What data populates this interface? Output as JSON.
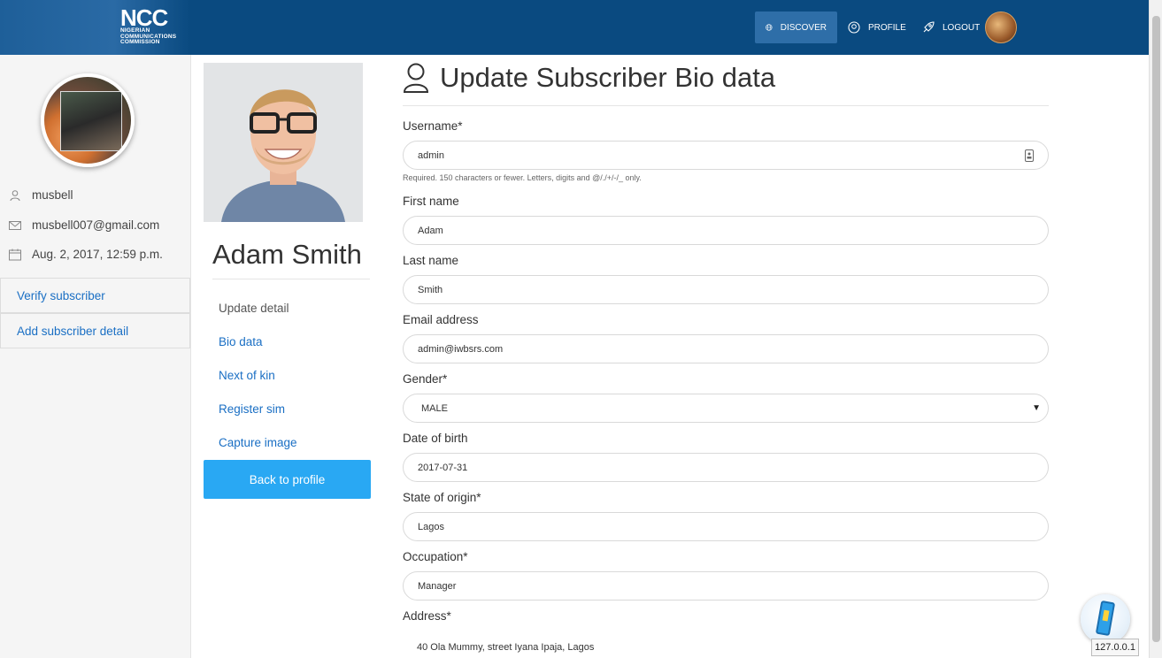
{
  "nav": {
    "items": [
      {
        "label": "DISCOVER",
        "icon": "globe-icon",
        "active": true
      },
      {
        "label": "PROFILE",
        "icon": "user-circle-icon",
        "active": false
      },
      {
        "label": "LOGOUT",
        "icon": "rocket-icon",
        "active": false
      }
    ],
    "logo": {
      "big": "NCC",
      "line1": "NIGERIAN",
      "line2": "COMMUNICATIONS",
      "line3": "COMMISSION"
    },
    "colors": {
      "bar": "#0a4a80",
      "active": "#2e6ea8"
    }
  },
  "sidebar": {
    "username": "musbell",
    "email": "musbell007@gmail.com",
    "date": "Aug. 2, 2017, 12:59 p.m.",
    "links": [
      "Verify subscriber",
      "Add subscriber detail"
    ]
  },
  "profile": {
    "name": "Adam Smith",
    "menu": [
      {
        "label": "Update detail",
        "muted": true
      },
      {
        "label": "Bio data",
        "muted": false
      },
      {
        "label": "Next of kin",
        "muted": false
      },
      {
        "label": "Register sim",
        "muted": false
      },
      {
        "label": "Capture image",
        "muted": false
      }
    ],
    "back_button": "Back to profile"
  },
  "form": {
    "title": "Update Subscriber Bio data",
    "username": {
      "label": "Username*",
      "value": "admin",
      "help": "Required. 150 characters or fewer. Letters, digits and @/./+/-/_ only."
    },
    "first_name": {
      "label": "First name",
      "value": "Adam"
    },
    "last_name": {
      "label": "Last name",
      "value": "Smith"
    },
    "email": {
      "label": "Email address",
      "value": "admin@iwbsrs.com"
    },
    "gender": {
      "label": "Gender*",
      "value": "MALE"
    },
    "dob": {
      "label": "Date of birth",
      "value": "2017-07-31"
    },
    "state": {
      "label": "State of origin*",
      "value": "Lagos"
    },
    "occupation": {
      "label": "Occupation*",
      "value": "Manager"
    },
    "address": {
      "label": "Address*",
      "value": "40 Ola Mummy, street Iyana Ipaja, Lagos"
    }
  },
  "widget": {
    "ip": "127.0.0.1"
  },
  "accent": "#29a8f3"
}
